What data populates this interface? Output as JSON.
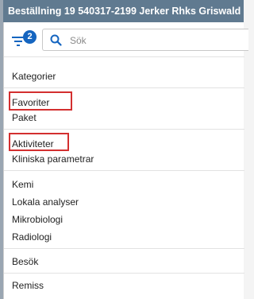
{
  "window": {
    "title": "Beställning 19 540317-2199 Jerker Rhks Griswald"
  },
  "toolbar": {
    "filter_badge": "2",
    "search_placeholder": "Sök",
    "accent_color": "#1565c0"
  },
  "sections": {
    "categories_heading": "Kategorier",
    "group1": [
      "Favoriter",
      "Paket"
    ],
    "group2": [
      "Aktiviteter",
      "Kliniska parametrar"
    ],
    "group3": [
      "Kemi",
      "Lokala analyser",
      "Mikrobiologi",
      "Radiologi"
    ],
    "group4": [
      "Besök"
    ],
    "group5": [
      "Remiss"
    ]
  },
  "highlight_color": "#d32f2f"
}
